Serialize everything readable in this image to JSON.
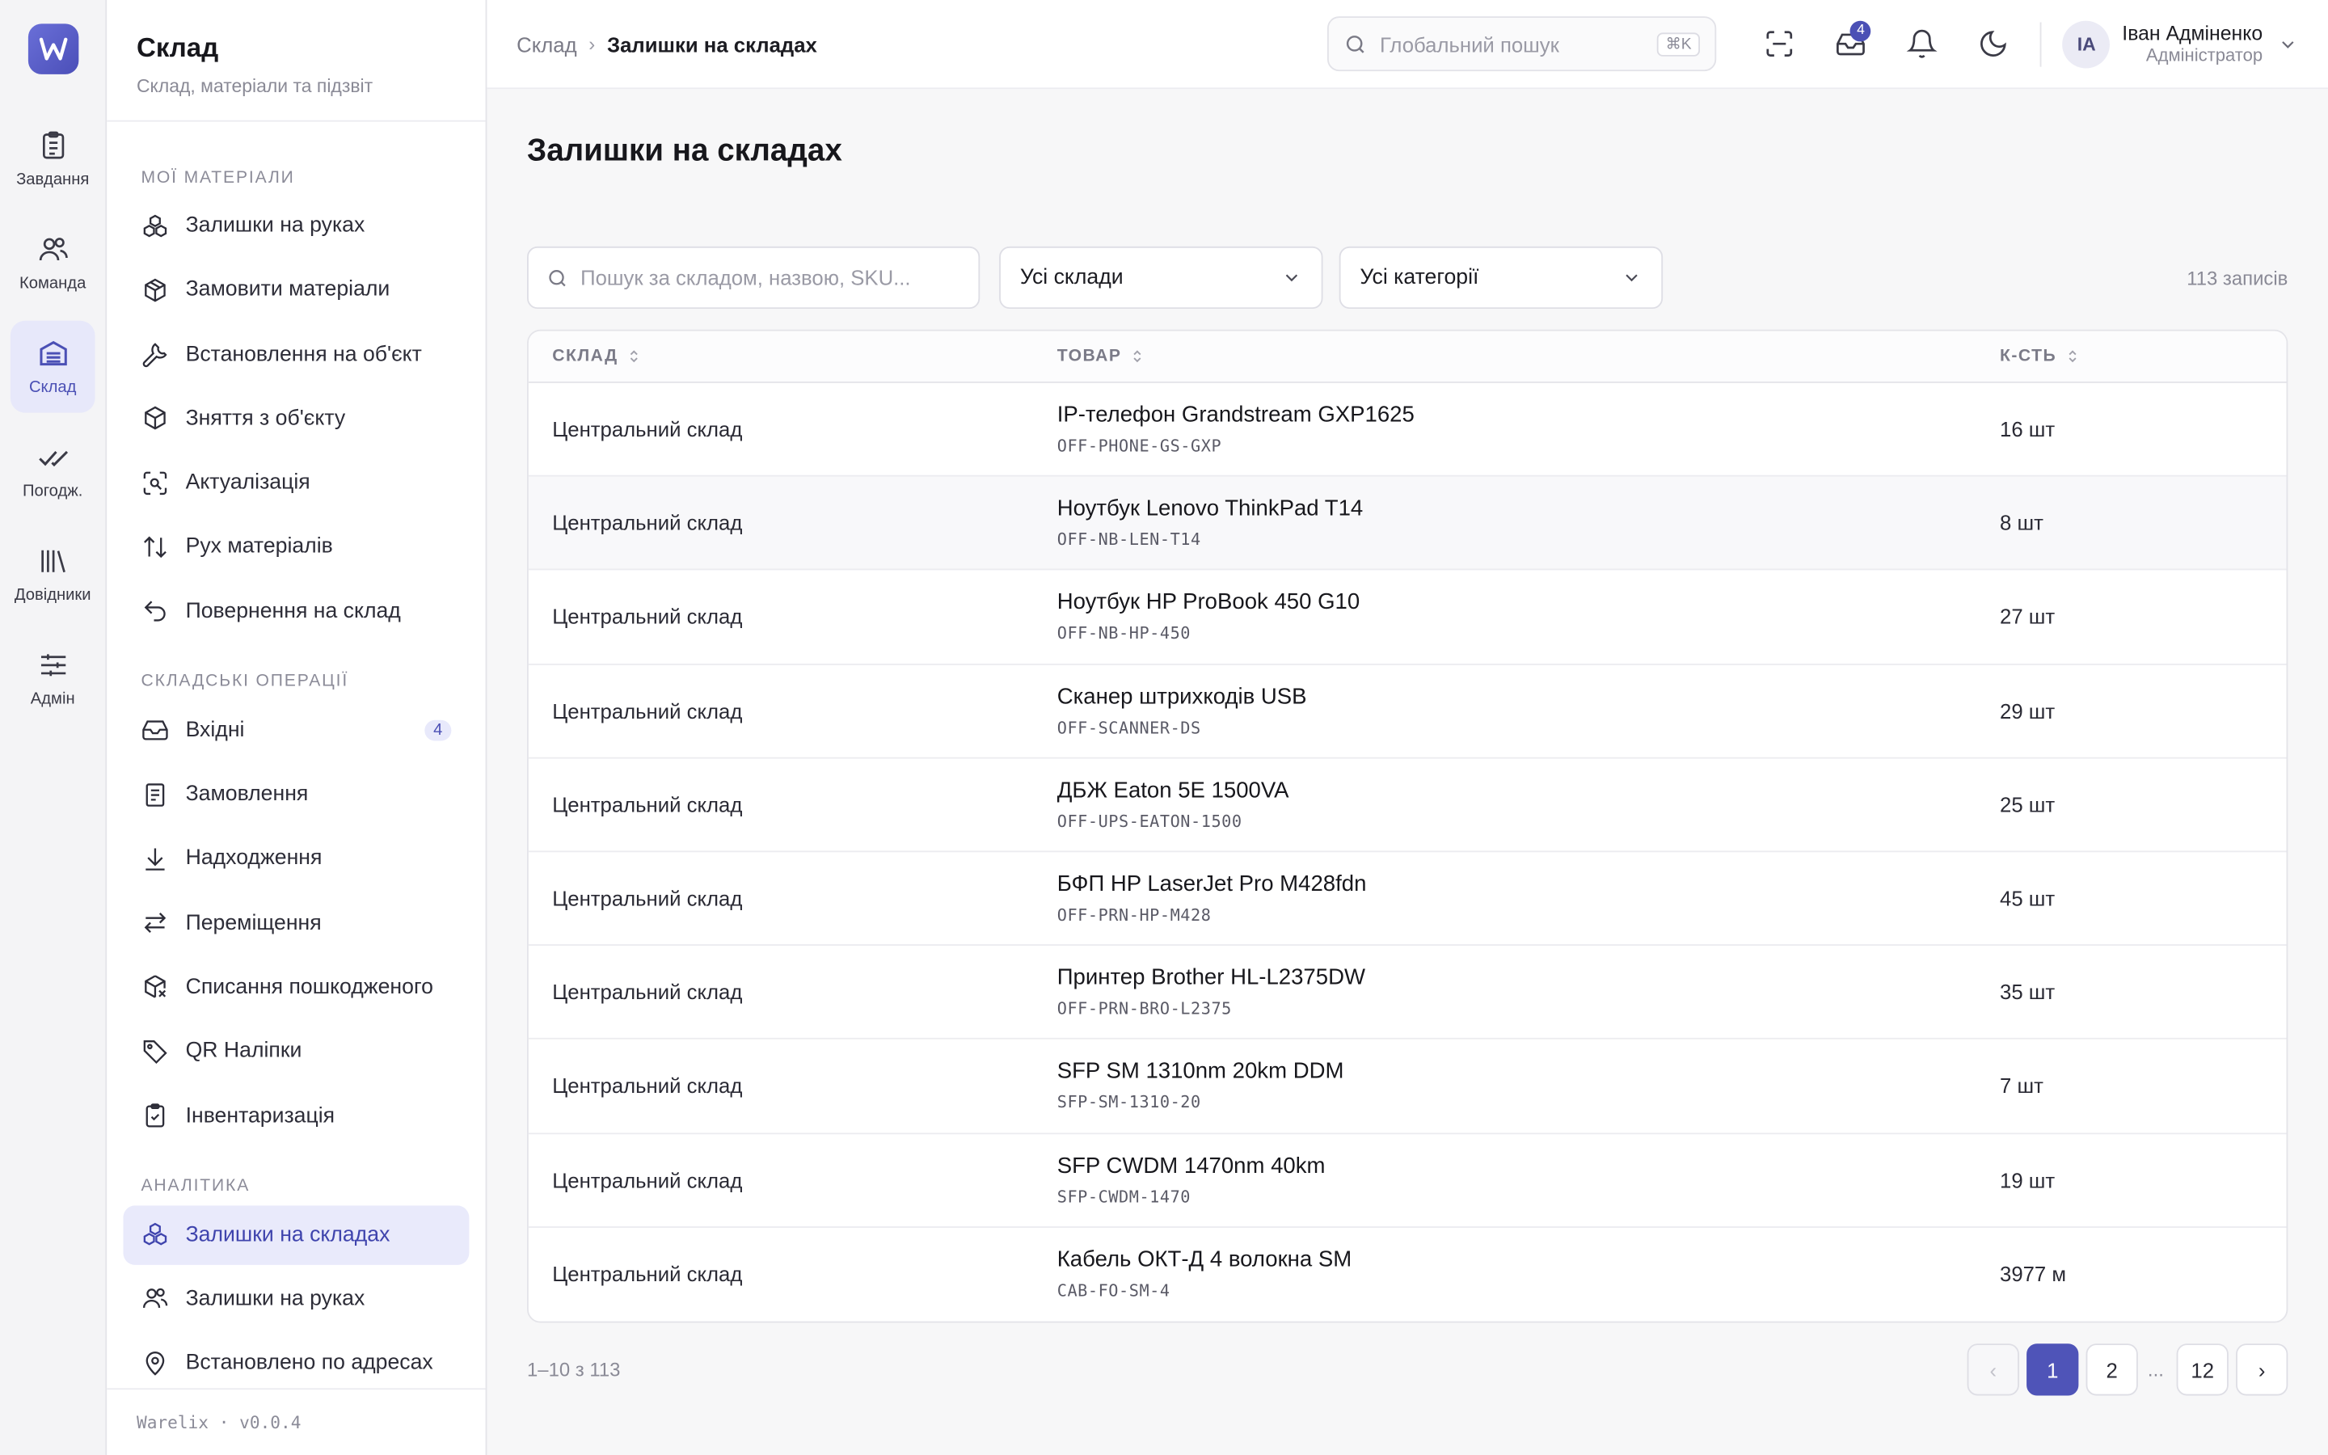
{
  "rail": {
    "items": [
      {
        "label": "Завдання",
        "icon": "clipboard-icon"
      },
      {
        "label": "Команда",
        "icon": "users-icon"
      },
      {
        "label": "Склад",
        "icon": "warehouse-icon"
      },
      {
        "label": "Погодж.",
        "icon": "double-check-icon"
      },
      {
        "label": "Довідники",
        "icon": "library-icon"
      },
      {
        "label": "Адмін",
        "icon": "sliders-icon"
      }
    ]
  },
  "sidebar": {
    "title": "Склад",
    "subtitle": "Склад, матеріали та підзвіт",
    "sections": [
      {
        "title": "МОЇ МАТЕРІАЛИ",
        "items": [
          {
            "label": "Залишки на руках",
            "icon": "boxes-icon"
          },
          {
            "label": "Замовити матеріали",
            "icon": "package-plus-icon"
          },
          {
            "label": "Встановлення на об'єкт",
            "icon": "wrench-icon"
          },
          {
            "label": "Зняття з об'єкту",
            "icon": "package-minus-icon"
          },
          {
            "label": "Актуалізація",
            "icon": "scan-icon"
          },
          {
            "label": "Рух матеріалів",
            "icon": "arrows-up-down-icon"
          },
          {
            "label": "Повернення на склад",
            "icon": "undo-icon"
          }
        ]
      },
      {
        "title": "СКЛАДСЬКІ ОПЕРАЦІЇ",
        "items": [
          {
            "label": "Вхідні",
            "icon": "inbox-icon",
            "badge": "4"
          },
          {
            "label": "Замовлення",
            "icon": "document-icon"
          },
          {
            "label": "Надходження",
            "icon": "download-icon"
          },
          {
            "label": "Переміщення",
            "icon": "transfer-icon"
          },
          {
            "label": "Списання пошкодженого",
            "icon": "package-x-icon"
          },
          {
            "label": "QR Наліпки",
            "icon": "tag-icon"
          },
          {
            "label": "Інвентаризація",
            "icon": "clipboard-check-icon"
          }
        ]
      },
      {
        "title": "АНАЛІТИКА",
        "items": [
          {
            "label": "Залишки на складах",
            "icon": "boxes-icon",
            "active": true
          },
          {
            "label": "Залишки на руках",
            "icon": "users-icon"
          },
          {
            "label": "Встановлено по адресах",
            "icon": "map-pin-icon"
          }
        ]
      }
    ],
    "footer": "Warelix · v0.0.4"
  },
  "topbar": {
    "breadcrumb_parent": "Склад",
    "breadcrumb_sep": "›",
    "breadcrumb_current": "Залишки на складах",
    "search_placeholder": "Глобальний пошук",
    "search_shortcut": "⌘K",
    "inbox_badge": "4",
    "user_initials": "IA",
    "user_name": "Іван Адміненко",
    "user_role": "Адміністратор"
  },
  "page": {
    "title": "Залишки на складах",
    "search_placeholder": "Пошук за складом, назвою, SKU...",
    "warehouse_filter": "Усі склади",
    "category_filter": "Усі категорії",
    "record_count": "113 записів"
  },
  "table": {
    "headers": {
      "warehouse": "СКЛАД",
      "item": "ТОВАР",
      "qty": "К-СТЬ"
    },
    "rows": [
      {
        "warehouse": "Центральний склад",
        "name": "IP-телефон Grandstream GXP1625",
        "sku": "OFF-PHONE-GS-GXP",
        "qty": "16 шт"
      },
      {
        "warehouse": "Центральний склад",
        "name": "Ноутбук Lenovo ThinkPad T14",
        "sku": "OFF-NB-LEN-T14",
        "qty": "8 шт"
      },
      {
        "warehouse": "Центральний склад",
        "name": "Ноутбук HP ProBook 450 G10",
        "sku": "OFF-NB-HP-450",
        "qty": "27 шт"
      },
      {
        "warehouse": "Центральний склад",
        "name": "Сканер штрихкодів USB",
        "sku": "OFF-SCANNER-DS",
        "qty": "29 шт"
      },
      {
        "warehouse": "Центральний склад",
        "name": "ДБЖ Eaton 5E 1500VA",
        "sku": "OFF-UPS-EATON-1500",
        "qty": "25 шт"
      },
      {
        "warehouse": "Центральний склад",
        "name": "БФП HP LaserJet Pro M428fdn",
        "sku": "OFF-PRN-HP-M428",
        "qty": "45 шт"
      },
      {
        "warehouse": "Центральний склад",
        "name": "Принтер Brother HL-L2375DW",
        "sku": "OFF-PRN-BRO-L2375",
        "qty": "35 шт"
      },
      {
        "warehouse": "Центральний склад",
        "name": "SFP SM 1310nm 20km DDM",
        "sku": "SFP-SM-1310-20",
        "qty": "7 шт"
      },
      {
        "warehouse": "Центральний склад",
        "name": "SFP CWDM 1470nm 40km",
        "sku": "SFP-CWDM-1470",
        "qty": "19 шт"
      },
      {
        "warehouse": "Центральний склад",
        "name": "Кабель ОКТ-Д 4 волокна SM",
        "sku": "CAB-FO-SM-4",
        "qty": "3977 м"
      }
    ]
  },
  "pagination": {
    "range": "1–10 з 113",
    "prev": "‹",
    "pages": [
      "1",
      "2"
    ],
    "dots": "...",
    "last": "12",
    "next": "›"
  },
  "colors": {
    "accent": "#4f54b8",
    "active_bg": "#e9eafb"
  }
}
